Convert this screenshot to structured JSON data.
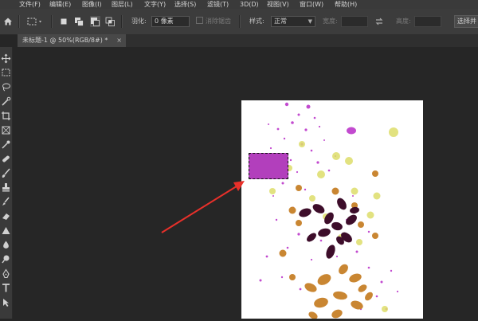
{
  "menu": {
    "items": [
      "文件(F)",
      "编辑(E)",
      "图像(I)",
      "图层(L)",
      "文字(Y)",
      "选择(S)",
      "滤镜(T)",
      "3D(D)",
      "视图(V)",
      "窗口(W)",
      "帮助(H)"
    ]
  },
  "options": {
    "feather_label": "羽化:",
    "feather_value": "0 像素",
    "antialias_label": "消除锯齿",
    "style_label": "样式:",
    "style_value": "正常",
    "width_label": "宽度:",
    "height_label": "高度:",
    "select_mask_label": "选择并"
  },
  "document": {
    "tab_title": "未标题-1 @ 50%(RGB/8#) *",
    "close_glyph": "×"
  },
  "colors": {
    "selection_fill": "#b23fbc",
    "arrow": "#e8302a",
    "dark_leaf": "#3d0d2a",
    "orange_leaf": "#c98632",
    "yellow_leaf": "#dede6a",
    "splatter": "#c24acf"
  },
  "tools": [
    "move-tool",
    "marquee-tool",
    "lasso-tool",
    "quick-select-tool",
    "crop-tool",
    "frame-tool",
    "eyedropper-tool",
    "healing-tool",
    "brush-tool",
    "stamp-tool",
    "history-brush-tool",
    "eraser-tool",
    "gradient-tool",
    "blur-tool",
    "dodge-tool",
    "pen-tool",
    "type-tool"
  ]
}
